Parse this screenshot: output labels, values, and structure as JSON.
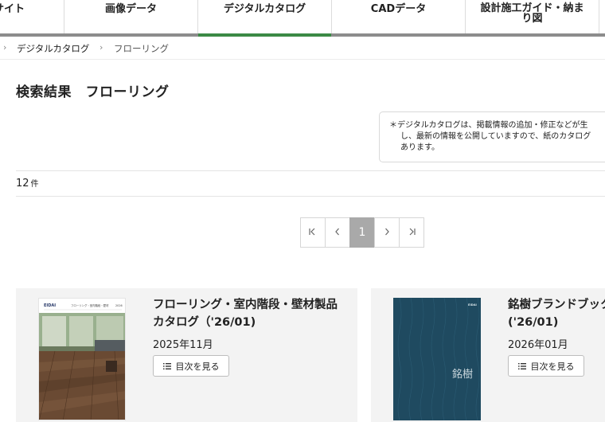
{
  "nav": {
    "items": [
      {
        "label": "サイト"
      },
      {
        "label": "画像データ"
      },
      {
        "label": "デジタルカタログ",
        "active": true
      },
      {
        "label": "CADデータ"
      },
      {
        "label": "設計施工ガイド・納ま\nり図"
      }
    ],
    "active_color": "#3b8a45"
  },
  "breadcrumb": {
    "items": [
      {
        "label": "デジタルカタログ"
      },
      {
        "label": "フローリング"
      }
    ]
  },
  "page_title": "検索結果　フローリング",
  "notice": {
    "lines": [
      "＊デジタルカタログは、掲載情報の追加・修正などが生",
      "し、最新の情報を公開していますので、紙のカタログ",
      "あります。"
    ]
  },
  "results": {
    "count": "12",
    "unit": "件"
  },
  "pagination": {
    "first": "|<",
    "prev": "<",
    "current": "1",
    "next": ">",
    "last": ">|"
  },
  "cards": [
    {
      "title_line1": "フローリング・室内階段・壁材製品",
      "title_line2": "カタログ（'26/01)",
      "date": "2025年11月",
      "toc_label": "目次を見る",
      "cover_brand": "EIDAI",
      "cover_heading": "フローリング・室内階段・壁材",
      "cover_year": "2026"
    },
    {
      "title_line1": "銘樹ブランドブック",
      "title_line2": "('26/01)",
      "date": "2026年01月",
      "toc_label": "目次を見る",
      "cover_brand": "EIDAI",
      "cover_heading": "銘樹",
      "cover_color": "#1f4a60"
    }
  ]
}
